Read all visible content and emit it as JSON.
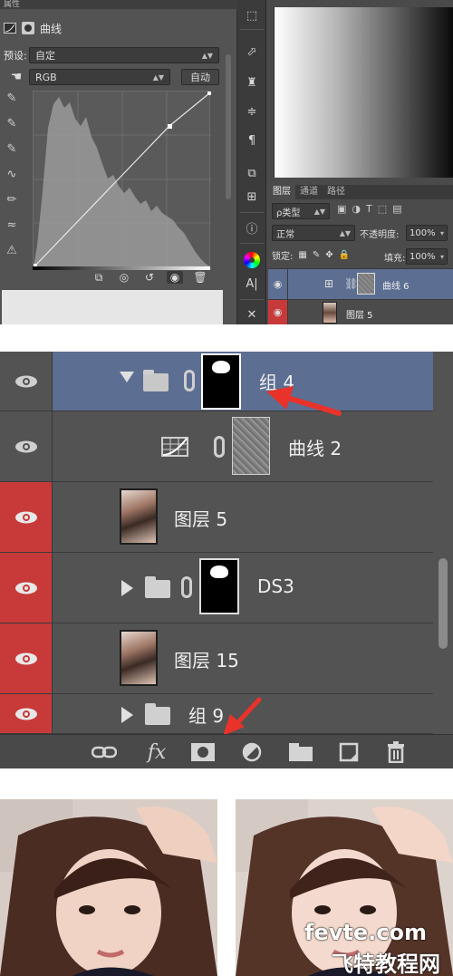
{
  "props_panel": {
    "tab_title": "属性",
    "adjust_title": "曲线",
    "preset_label": "预设:",
    "preset_value": "自定",
    "channel_value": "RGB",
    "auto_button": "自动"
  },
  "layers_small": {
    "tabs": [
      "图层",
      "通道",
      "路径"
    ],
    "filter_value": "ρ类型",
    "blend_mode": "正常",
    "opacity_label": "不透明度:",
    "opacity_value": "100%",
    "lock_label": "锁定:",
    "fill_label": "填充:",
    "fill_value": "100%",
    "rows": [
      {
        "name": "曲线 6"
      },
      {
        "name": "图层 5"
      }
    ]
  },
  "layers_big": {
    "rows": [
      {
        "name": "组 4"
      },
      {
        "name": "曲线 2"
      },
      {
        "name": "图层 5"
      },
      {
        "name": "DS3"
      },
      {
        "name": "图层 15"
      },
      {
        "name": "组 9"
      }
    ]
  },
  "colors": {
    "panel_bg": "#535353",
    "selected_row": "#5c6e92",
    "red_eye": "#c83a3a",
    "arrow_red": "#e8322a"
  },
  "watermark": {
    "line1": "fevte.com",
    "line2": "飞特教程网"
  }
}
